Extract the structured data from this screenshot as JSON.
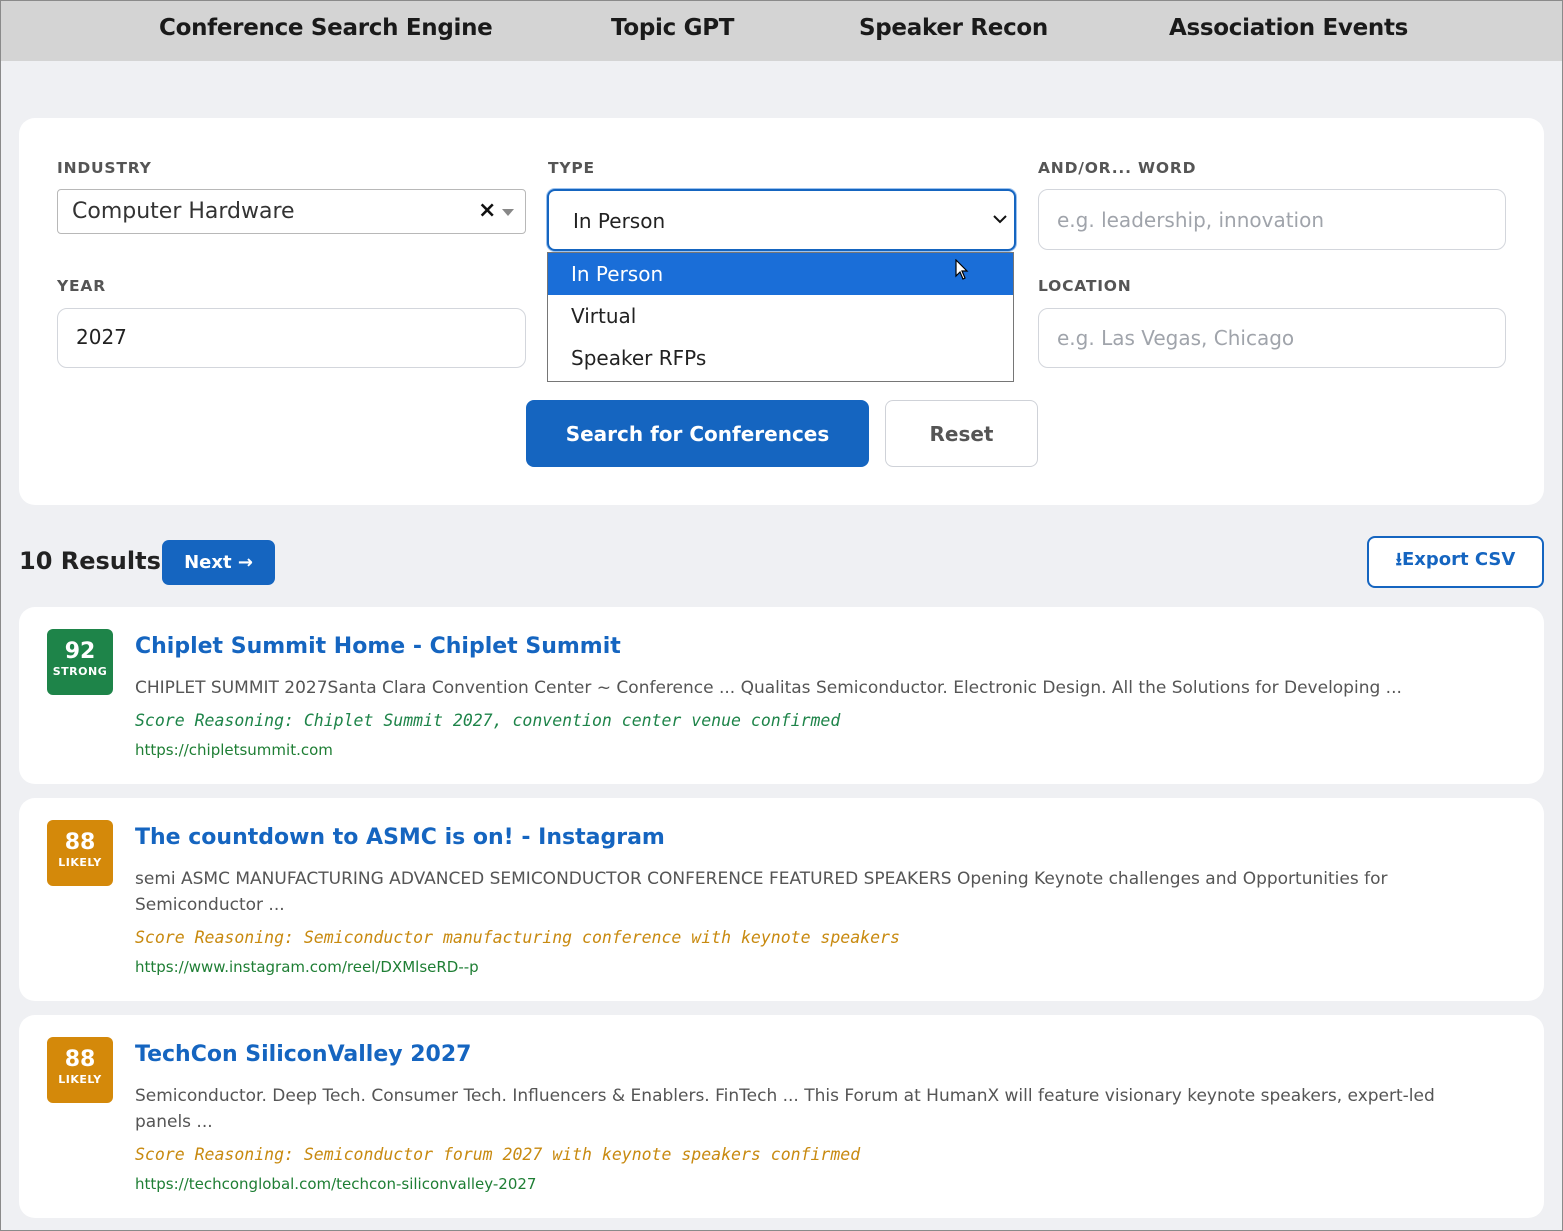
{
  "nav": {
    "items": [
      "Conference Search Engine",
      "Topic GPT",
      "Speaker Recon",
      "Association Events"
    ]
  },
  "search": {
    "industry_label": "INDUSTRY",
    "industry_value": "Computer Hardware",
    "industry_clear": "×",
    "type_label": "TYPE",
    "type_value": "In Person",
    "type_options": [
      "In Person",
      "Virtual",
      "Speaker RFPs"
    ],
    "word_label": "AND/OR... WORD",
    "word_placeholder": "e.g. leadership, innovation",
    "year_label": "YEAR",
    "year_value": "2027",
    "location_label": "LOCATION",
    "location_placeholder": "e.g. Las Vegas, Chicago",
    "search_button": "Search for Conferences",
    "reset_button": "Reset"
  },
  "results_header": {
    "count": "10 Results",
    "next_button": "Next →",
    "export_button": "⭳Export CSV"
  },
  "results": [
    {
      "score": "92",
      "score_label": "STRONG",
      "color": "#1e8449",
      "title": "Chiplet Summit Home - Chiplet Summit",
      "snippet": "CHIPLET SUMMIT 2027Santa Clara Convention Center ~ Conference ... Qualitas Semiconductor. Electronic Design. All the Solutions for Developing ...",
      "reasoning": "Score Reasoning: Chiplet Summit 2027, convention center venue confirmed",
      "url": "https://chipletsummit.com"
    },
    {
      "score": "88",
      "score_label": "LIKELY",
      "color": "#d4890a",
      "title": "The countdown to ASMC is on! - Instagram",
      "snippet": "semi ASMC MANUFACTURING ADVANCED SEMICONDUCTOR CONFERENCE FEATURED SPEAKERS Opening Keynote challenges and Opportunities for Semiconductor ...",
      "reasoning": "Score Reasoning: Semiconductor manufacturing conference with keynote speakers",
      "url": "https://www.instagram.com/reel/DXMlseRD--p"
    },
    {
      "score": "88",
      "score_label": "LIKELY",
      "color": "#d4890a",
      "title": "TechCon SiliconValley 2027",
      "snippet": "Semiconductor. Deep Tech. Consumer Tech. Influencers & Enablers. FinTech ... This Forum at HumanX will feature visionary keynote speakers, expert-led panels ...",
      "reasoning": "Score Reasoning: Semiconductor forum 2027 with keynote speakers confirmed",
      "url": "https://techconglobal.com/techcon-siliconvalley-2027"
    }
  ]
}
